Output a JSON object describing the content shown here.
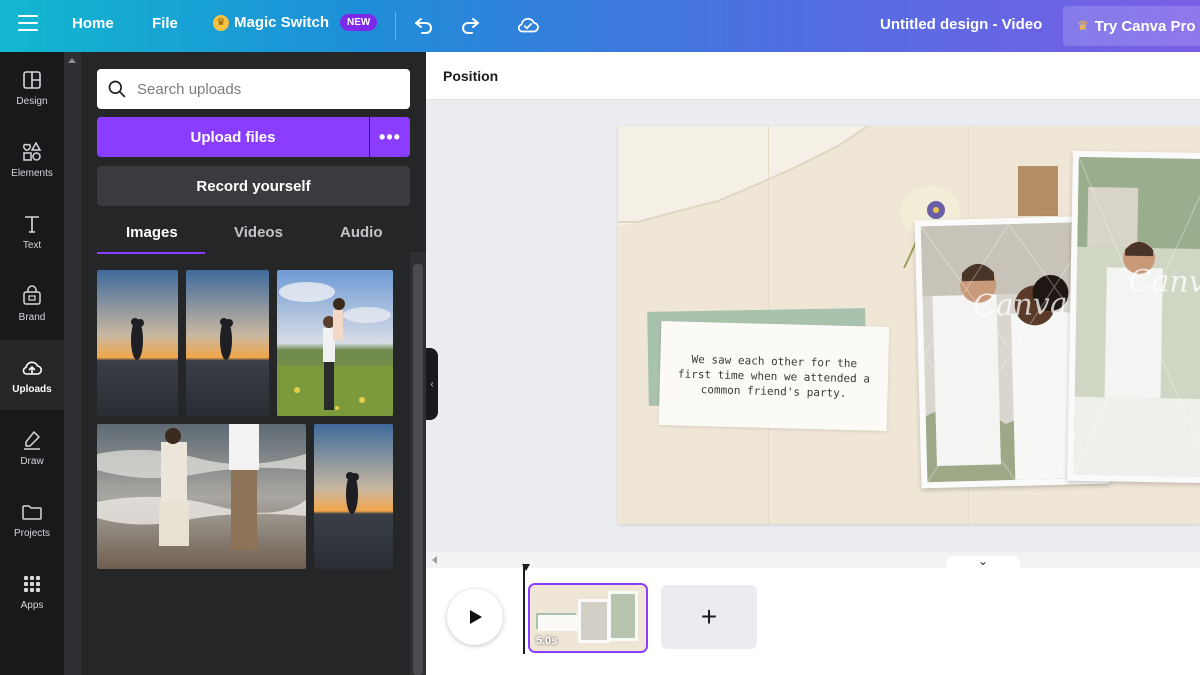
{
  "topbar": {
    "home": "Home",
    "file": "File",
    "magic_switch": "Magic Switch",
    "new_badge": "NEW",
    "design_title": "Untitled design - Video",
    "try_pro": "Try Canva Pro"
  },
  "rail": {
    "items": [
      {
        "label": "Design",
        "icon": "layout-icon"
      },
      {
        "label": "Elements",
        "icon": "shapes-icon"
      },
      {
        "label": "Text",
        "icon": "text-icon"
      },
      {
        "label": "Brand",
        "icon": "brand-icon"
      },
      {
        "label": "Uploads",
        "icon": "cloud-upload-icon",
        "active": true
      },
      {
        "label": "Draw",
        "icon": "pen-icon"
      },
      {
        "label": "Projects",
        "icon": "folder-icon"
      },
      {
        "label": "Apps",
        "icon": "apps-grid-icon"
      }
    ]
  },
  "panel": {
    "search_placeholder": "Search uploads",
    "upload_label": "Upload files",
    "more_label": "•••",
    "record_label": "Record yourself",
    "tabs": [
      "Images",
      "Videos",
      "Audio"
    ],
    "active_tab": "Images"
  },
  "context_bar": {
    "position_label": "Position"
  },
  "design": {
    "quote": "We saw each other for the first time when we attended a common friend's party.",
    "watermark": "Canva"
  },
  "timeline": {
    "clip_duration": "5.0s",
    "add_label": "+"
  },
  "colors": {
    "accent": "#8b3dff",
    "rail_bg": "#18191b",
    "panel_bg": "#252627"
  }
}
